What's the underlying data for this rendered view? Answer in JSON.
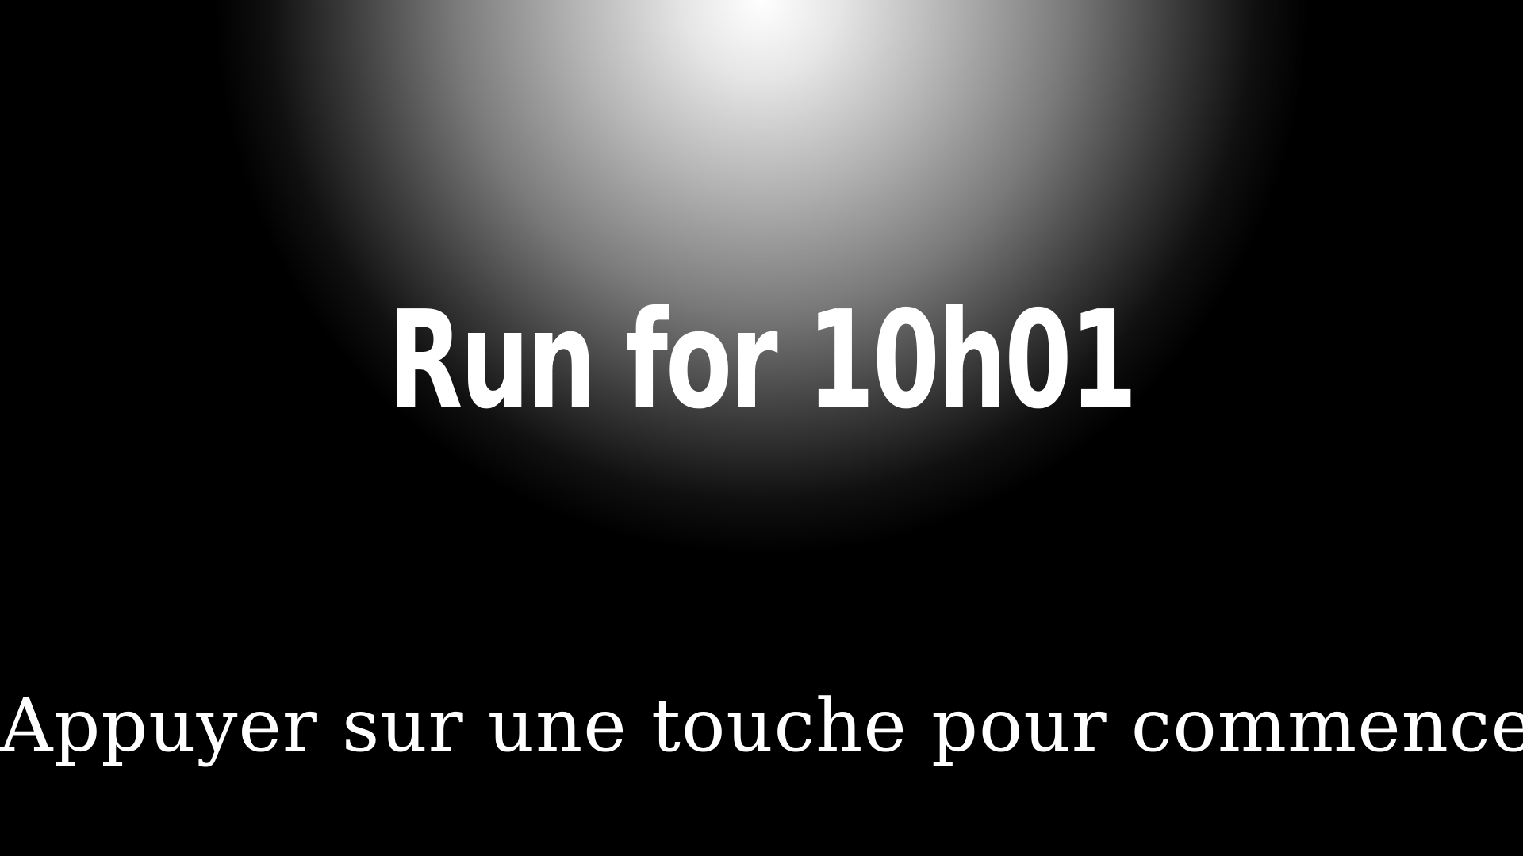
{
  "screen": {
    "background_color": "#000000",
    "spotlight_color": "#ffffff",
    "title": "Run for 10h01",
    "prompt": "Appuyer sur une touche pour commencer"
  }
}
